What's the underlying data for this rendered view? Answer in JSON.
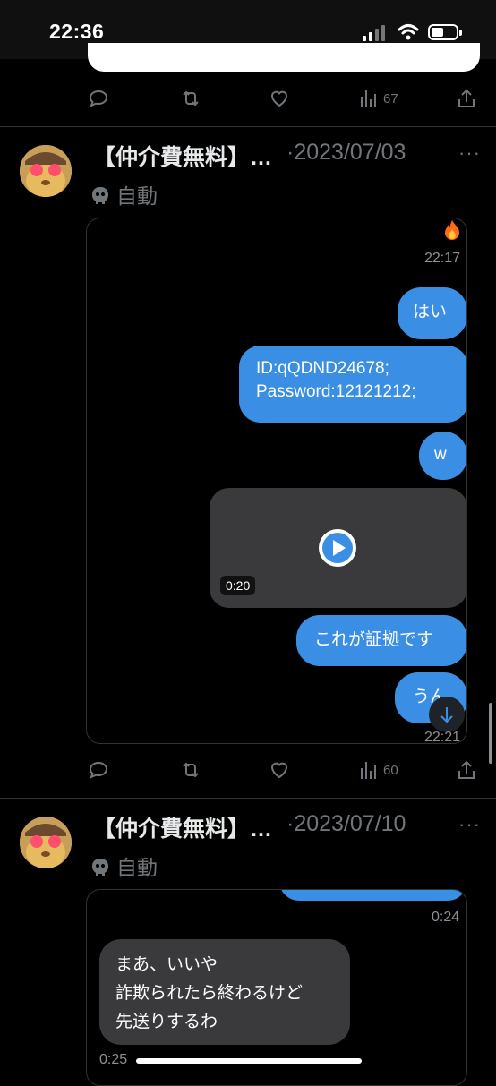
{
  "status_bar": {
    "time": "22:36"
  },
  "previous_post": {
    "views": "67"
  },
  "posts": [
    {
      "name": "【仲介費無料】…",
      "dot": "·",
      "date": "2023/07/03",
      "tag": "自動",
      "timestamp_top": "22:17",
      "messages": [
        "はい",
        "ID:qQDND24678;",
        "Password:12121212;",
        "w",
        "これが証拠です",
        "うん"
      ],
      "video_duration": "0:20",
      "timestamp_bottom": "22:21",
      "views": "60"
    },
    {
      "name": "【仲介費無料】…",
      "dot": "·",
      "date": "2023/07/10",
      "tag": "自動",
      "timestamp_top": "0:24",
      "received_lines": [
        "まあ、いいや",
        "詐欺られたら終わるけど",
        "先送りするわ"
      ],
      "timestamp_bottom": "0:25"
    }
  ],
  "icons": {
    "reply": "reply-icon",
    "repost": "repost-icon",
    "like": "heart-icon",
    "views": "views-icon",
    "share": "share-icon",
    "bot": "bot-icon",
    "fire": "fire-icon",
    "play": "play-icon",
    "scroll_down": "arrow-down-icon"
  },
  "colors": {
    "bubble": "#3a8ee3",
    "received_bubble": "#3a3a3c",
    "muted": "#71767b",
    "background": "#000000"
  }
}
